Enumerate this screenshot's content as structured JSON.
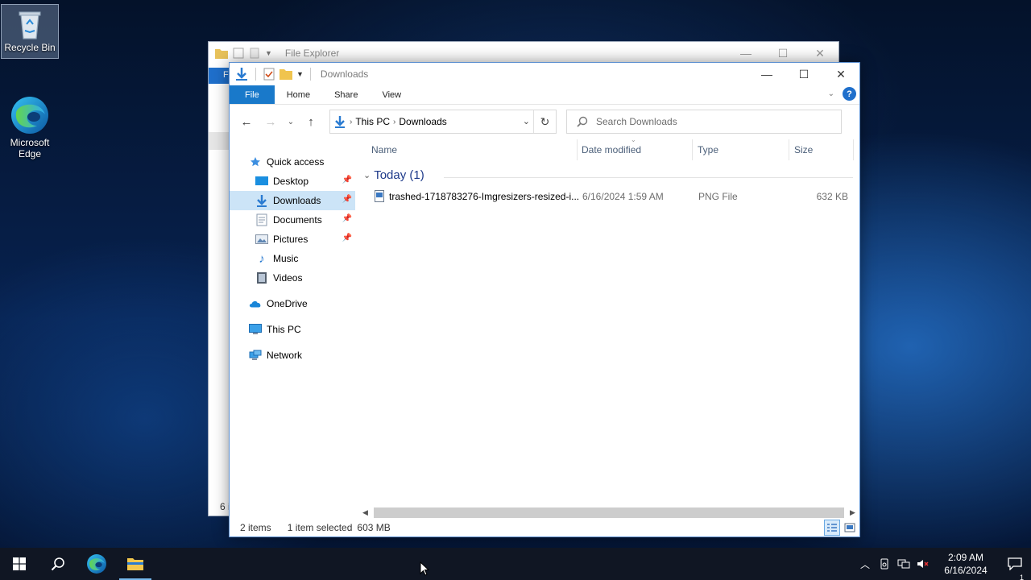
{
  "desktop": {
    "icons": [
      {
        "label": "Recycle Bin",
        "icon": "recycle-bin-icon"
      },
      {
        "label": "Microsoft Edge",
        "icon": "edge-icon"
      }
    ]
  },
  "back_window": {
    "title": "File Explorer",
    "file_tab": "F",
    "status_fragment": "6 i"
  },
  "window": {
    "title": "Downloads",
    "ribbon_tabs": [
      "File",
      "Home",
      "Share",
      "View"
    ],
    "address": {
      "crumbs": [
        "This PC",
        "Downloads"
      ]
    },
    "search_placeholder": "Search Downloads",
    "sidebar": {
      "quick_access": "Quick access",
      "items": [
        {
          "label": "Desktop",
          "pinned": true
        },
        {
          "label": "Downloads",
          "pinned": true,
          "selected": true
        },
        {
          "label": "Documents",
          "pinned": true
        },
        {
          "label": "Pictures",
          "pinned": true
        },
        {
          "label": "Music",
          "pinned": false
        },
        {
          "label": "Videos",
          "pinned": false
        }
      ],
      "onedrive": "OneDrive",
      "this_pc": "This PC",
      "network": "Network"
    },
    "columns": [
      "Name",
      "Date modified",
      "Type",
      "Size"
    ],
    "group": "Today (1)",
    "files": [
      {
        "name": "trashed-1718783276-Imgresizers-resized-i...",
        "date": "6/16/2024 1:59 AM",
        "type": "PNG File",
        "size": "632 KB"
      }
    ],
    "status": {
      "items": "2 items",
      "selected": "1 item selected",
      "size": "603 MB"
    }
  },
  "taskbar": {
    "time": "2:09 AM",
    "date": "6/16/2024",
    "notification_count": "1"
  },
  "colors": {
    "accent": "#1979ca",
    "selection": "#cce4f7",
    "taskbar": "#101623"
  }
}
